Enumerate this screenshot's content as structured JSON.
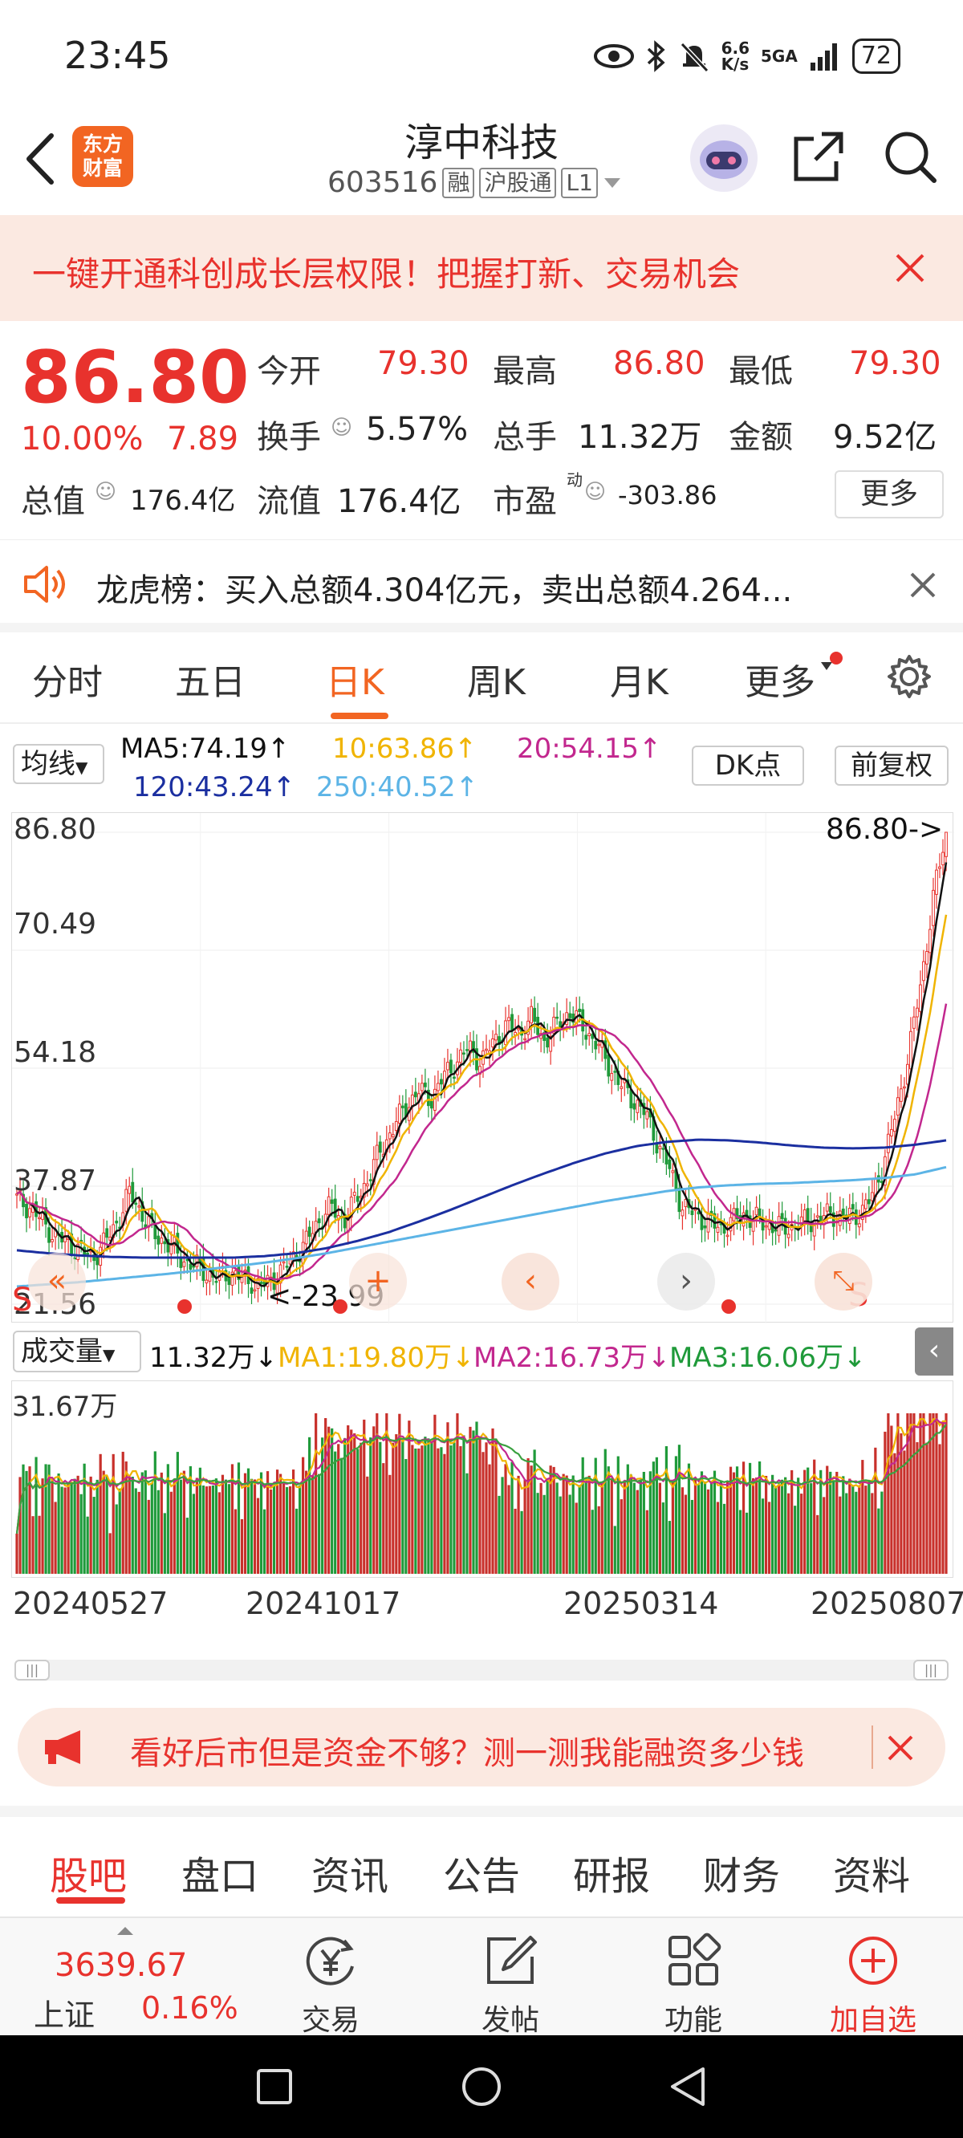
{
  "status_bar": {
    "time": "23:45",
    "net_speed_top": "6.6",
    "net_speed_bottom": "K/s",
    "network": "5GA",
    "battery": "72"
  },
  "header": {
    "title": "淳中科技",
    "code": "603516",
    "tags": [
      "融",
      "沪股通",
      "L1"
    ],
    "logo_line1": "东方",
    "logo_line2": "财富"
  },
  "banner": {
    "text": "一键开通科创成长层权限！把握打新、交易机会"
  },
  "quote": {
    "price": "86.80",
    "change_pct": "10.00%",
    "change": "7.89",
    "open_label": "今开",
    "open": "79.30",
    "high_label": "最高",
    "high": "86.80",
    "low_label": "最低",
    "low": "79.30",
    "turnover_label": "换手",
    "turnover": "5.57%",
    "volume_label": "总手",
    "volume": "11.32万",
    "amount_label": "金额",
    "amount": "9.52亿",
    "mktcap_label": "总值",
    "mktcap": "176.4亿",
    "float_label": "流值",
    "float": "176.4亿",
    "pe_label": "市盈",
    "pe_sup": "动",
    "pe": "-303.86",
    "more_button": "更多"
  },
  "lhb": {
    "text": "龙虎榜：买入总额4.304亿元，卖出总额4.264..."
  },
  "kline_tabs": [
    "分时",
    "五日",
    "日K",
    "周K",
    "月K",
    "更多"
  ],
  "kline_active": "日K",
  "ma_row": {
    "selector": "均线",
    "ma5": "MA5:74.19↑",
    "ma10": "10:63.86↑",
    "ma20": "20:54.15↑",
    "ma120": "120:43.24↑",
    "ma250": "250:40.52↑",
    "dk_button": "DK点",
    "adjust_button": "前复权"
  },
  "chart_labels": {
    "y_ticks": [
      "86.80",
      "70.49",
      "54.18",
      "37.87",
      "21.56"
    ],
    "max_marker": "86.80->",
    "min_marker": "<-23.99",
    "s_left": "S",
    "s_right": "S"
  },
  "volume_row": {
    "selector": "成交量",
    "vol": "11.32万↓",
    "ma1": "MA1:19.80万↓",
    "ma2": "MA2:16.73万↓",
    "ma3": "MA3:16.06万↓",
    "max_label": "31.67万"
  },
  "x_dates": [
    "20240527",
    "20241017",
    "20250314",
    "20250807"
  ],
  "promo": {
    "text": "看好后市但是资金不够？测一测我能融资多少钱"
  },
  "bottom_tabs": [
    "股吧",
    "盘口",
    "资讯",
    "公告",
    "研报",
    "财务",
    "资料"
  ],
  "bottom_tabs_active": "股吧",
  "bottom_bar": {
    "index_value": "3639.67",
    "index_name": "上证",
    "index_change": "0.16%",
    "trade": "交易",
    "post": "发帖",
    "functions": "功能",
    "add_watch": "加自选"
  },
  "colors": {
    "up": "#e8322d",
    "down": "#1f9a3a",
    "ma5": "#111111",
    "ma10": "#f0b400",
    "ma20": "#c2278e",
    "ma120": "#1b2fa0",
    "ma250": "#5cb4e6",
    "accent": "#f26522"
  },
  "chart_data": {
    "type": "candlestick",
    "y_axis": {
      "min": 21.56,
      "max": 86.8,
      "ticks": [
        86.8,
        70.49,
        54.18,
        37.87,
        21.56
      ]
    },
    "x_labels": [
      "20240527",
      "20241017",
      "20250314",
      "20250807"
    ],
    "close_series": [
      36,
      35,
      33,
      31,
      30,
      29,
      28,
      30,
      33,
      37,
      34,
      31,
      30,
      28,
      27,
      26,
      25,
      26,
      25,
      24,
      24.5,
      26,
      28,
      30,
      33,
      35,
      33,
      36,
      39,
      43,
      46,
      49,
      51,
      50,
      53,
      55,
      57,
      55,
      58,
      60,
      59,
      61,
      58,
      60,
      62,
      60,
      58,
      55,
      52,
      50,
      48,
      44,
      40,
      35,
      34,
      33,
      32,
      33,
      34,
      33,
      32.5,
      32,
      32.5,
      33,
      33.5,
      34,
      33.5,
      34,
      36,
      41,
      48,
      56,
      66,
      78,
      86.8
    ],
    "ma120_series": [
      29,
      28.6,
      28.3,
      28.1,
      28,
      28,
      28,
      28,
      28.2,
      28.6,
      29.3,
      30.3,
      31.5,
      33,
      34.6,
      36.3,
      38,
      39.6,
      41.1,
      42.4,
      43.4,
      44,
      44.3,
      44.2,
      43.9,
      43.5,
      43.2,
      43.1,
      43.2,
      43.6,
      44.2
    ],
    "ma250_series": [
      24,
      24.3,
      24.6,
      25,
      25.4,
      25.8,
      26.3,
      26.8,
      27.3,
      27.9,
      28.6,
      29.4,
      30.2,
      31,
      31.8,
      32.6,
      33.4,
      34.2,
      35,
      35.8,
      36.5,
      37.2,
      37.7,
      38,
      38.2,
      38.3,
      38.5,
      38.7,
      39,
      39.5,
      40.5
    ],
    "volume_max": "31.67万",
    "legend": [
      "MA5:74.19",
      "10:63.86",
      "20:54.15",
      "120:43.24",
      "250:40.52"
    ]
  }
}
